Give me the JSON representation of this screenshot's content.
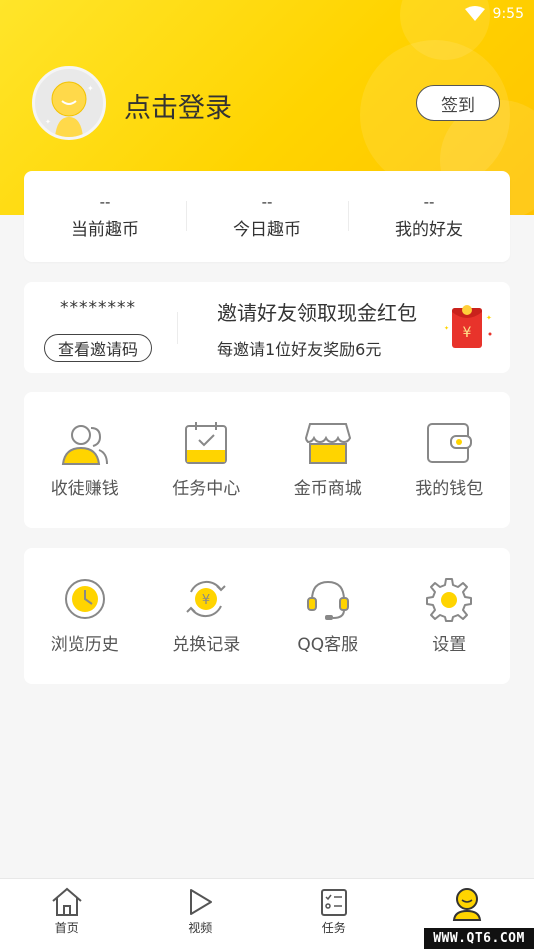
{
  "status_bar": {
    "time": "9:55",
    "icon": "wifi-icon"
  },
  "profile": {
    "login_text": "点击登录",
    "signin_button": "签到",
    "avatar_icon": "avatar-icon"
  },
  "stats": [
    {
      "value": "--",
      "label": "当前趣币"
    },
    {
      "value": "--",
      "label": "今日趣币"
    },
    {
      "value": "--",
      "label": "我的好友"
    }
  ],
  "invite": {
    "code_mask": "********",
    "view_code_button": "查看邀请码",
    "title": "邀请好友领取现金红包",
    "subtitle": "每邀请1位好友奖励6元",
    "packet_symbol": "¥",
    "icon": "red-packet-icon"
  },
  "menu_row1": [
    {
      "label": "收徒赚钱",
      "icon": "users-icon"
    },
    {
      "label": "任务中心",
      "icon": "calendar-check-icon"
    },
    {
      "label": "金币商城",
      "icon": "shop-icon"
    },
    {
      "label": "我的钱包",
      "icon": "wallet-icon"
    }
  ],
  "menu_row2": [
    {
      "label": "浏览历史",
      "icon": "clock-icon"
    },
    {
      "label": "兑换记录",
      "icon": "exchange-yuan-icon"
    },
    {
      "label": "QQ客服",
      "icon": "headset-icon"
    },
    {
      "label": "设置",
      "icon": "gear-icon"
    }
  ],
  "exchange_symbol": "¥",
  "tabbar": [
    {
      "label": "首页",
      "icon": "home-icon"
    },
    {
      "label": "视频",
      "icon": "play-icon"
    },
    {
      "label": "任务",
      "icon": "task-list-icon"
    },
    {
      "label": "",
      "icon": "profile-icon",
      "active": true
    }
  ],
  "watermark": "WWW.QT6.COM",
  "colors": {
    "accent": "#ffd400",
    "accent_dark": "#ffc300",
    "red_packet": "#e8332b",
    "icon_gray": "#888888"
  }
}
